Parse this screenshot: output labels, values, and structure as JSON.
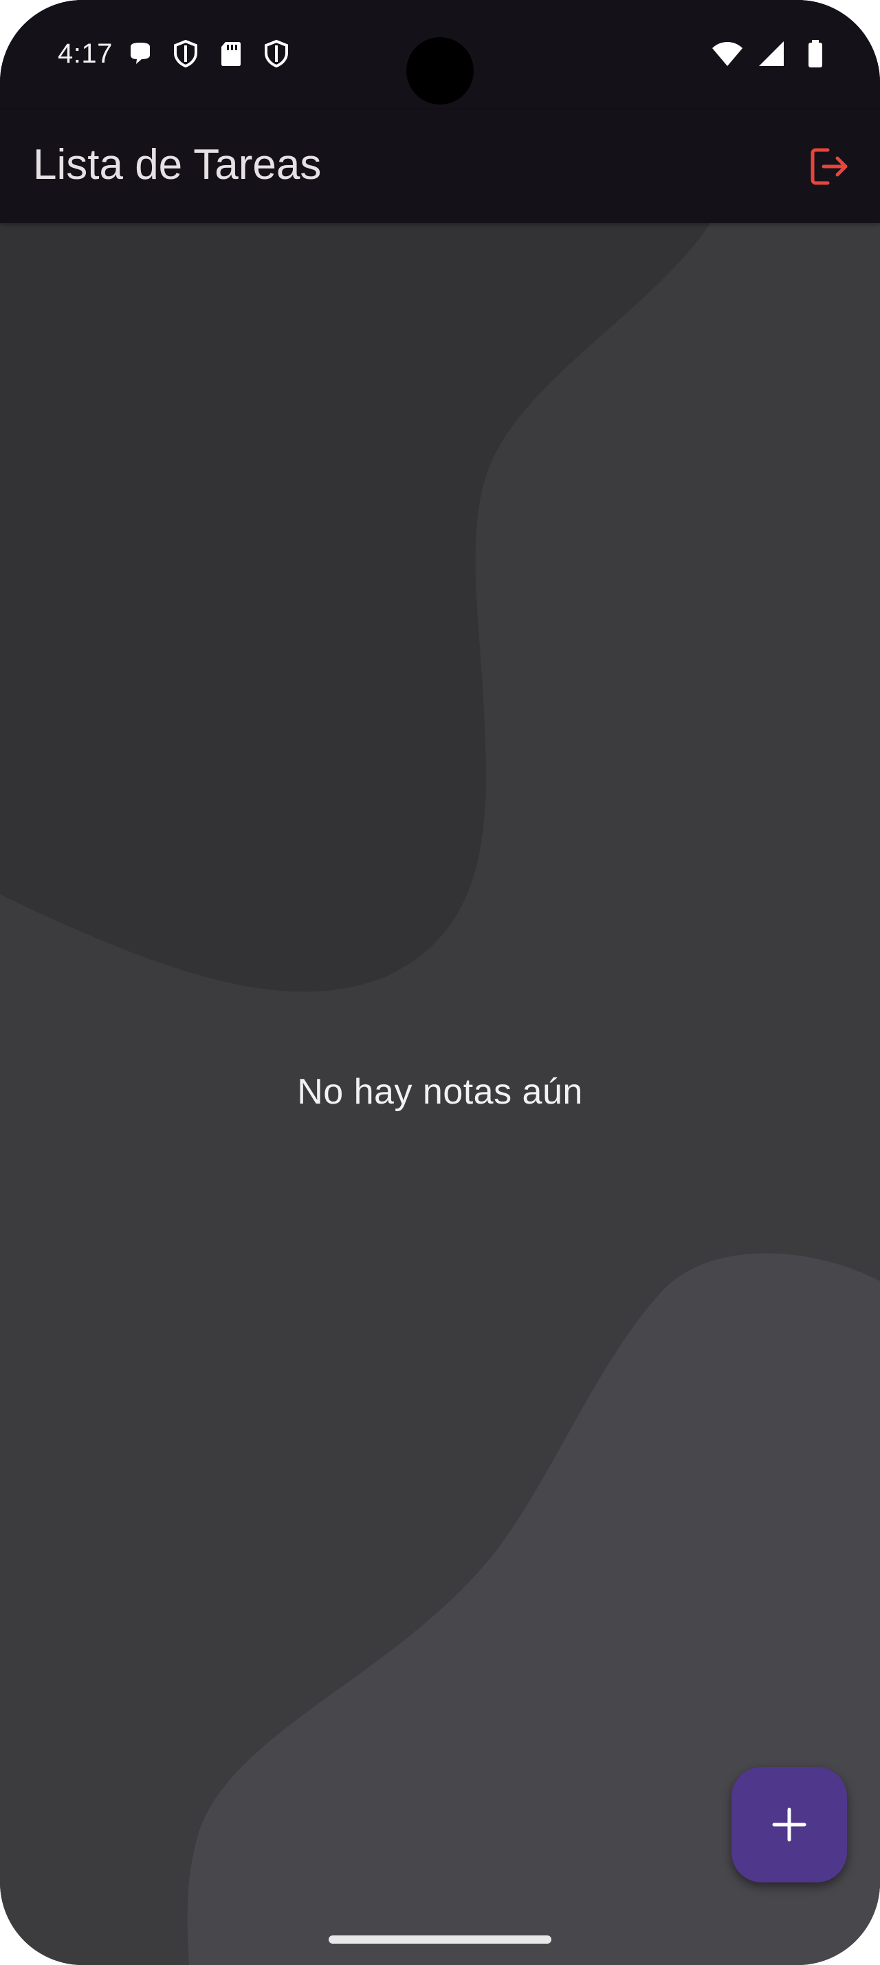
{
  "status_bar": {
    "time": "4:17",
    "left_icons": [
      "chat-bubble-icon",
      "shield-icon",
      "sd-card-icon",
      "shield-icon"
    ],
    "right_icons": [
      "wifi-icon",
      "cellular-signal-icon",
      "battery-icon"
    ]
  },
  "app_bar": {
    "title": "Lista de Tareas",
    "action_icon": "logout-icon",
    "action_color": "#e8453c"
  },
  "main": {
    "empty_message": "No hay notas aún"
  },
  "fab": {
    "icon": "plus-icon",
    "color": "#4f378b"
  },
  "colors": {
    "app_bar_background": "#141218",
    "page_background": "#3c3c3e",
    "wave_dark": "#333335",
    "wave_light": "#48474c"
  }
}
